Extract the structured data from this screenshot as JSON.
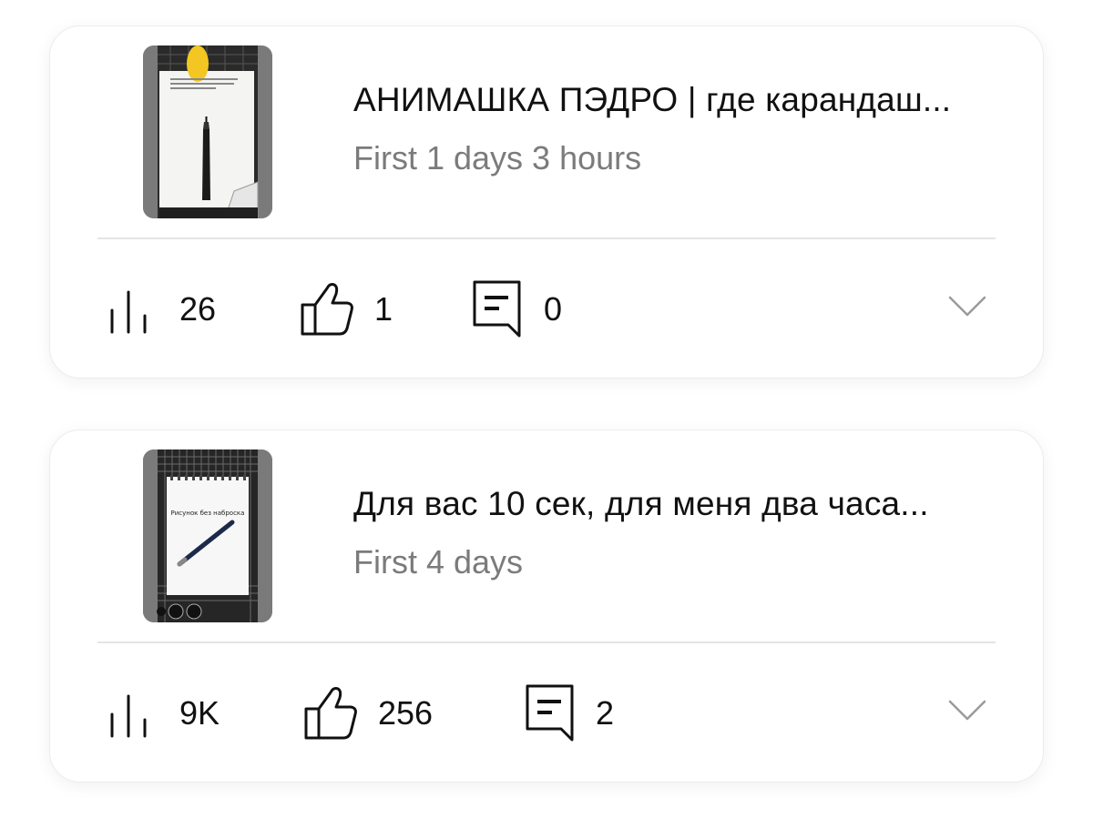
{
  "colors": {
    "card_border": "#ececec",
    "divider": "#e4e4e4",
    "text_primary": "#111111",
    "text_secondary": "#7b7b7b"
  },
  "posts": [
    {
      "title": "АНИМАШКА ПЭДРО | где карандаш...",
      "subtitle": "First 1 days 3 hours",
      "thumbnail_icon": "video-thumbnail-pen-on-paper",
      "stats": {
        "views": "26",
        "likes": "1",
        "comments": "0"
      },
      "expand_icon": "chevron-down-icon"
    },
    {
      "title": "Для вас 10 сек, для меня два часа...",
      "subtitle": "First 4 days",
      "thumbnail_icon": "video-thumbnail-drawing-pad",
      "thumbnail_caption": "Рисунок без наброска",
      "stats": {
        "views": "9K",
        "likes": "256",
        "comments": "2"
      },
      "expand_icon": "chevron-down-icon"
    }
  ]
}
